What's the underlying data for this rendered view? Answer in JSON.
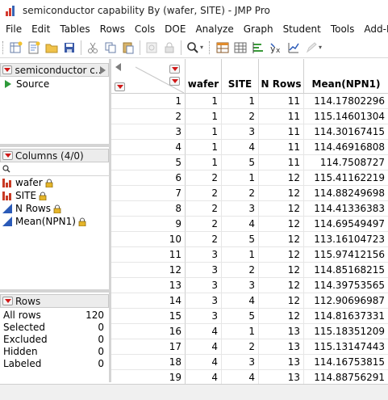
{
  "window": {
    "title": "semiconductor capability By (wafer, SITE) - JMP Pro"
  },
  "menu": [
    "File",
    "Edit",
    "Tables",
    "Rows",
    "Cols",
    "DOE",
    "Analyze",
    "Graph",
    "Student",
    "Tools",
    "Add-Ins"
  ],
  "toolbar": {
    "icons": [
      "new-table-icon",
      "new-script-icon",
      "open-icon",
      "save-icon",
      "cut-icon",
      "copy-icon",
      "paste-icon",
      "disabled-icon",
      "lock-icon",
      "search-icon",
      "data-table-icon",
      "grid-icon",
      "distribution-icon",
      "fit-icon",
      "graph-builder-icon",
      "disabled-edit-icon"
    ]
  },
  "table_panel": {
    "title": "semiconductor c...",
    "source_label": "Source"
  },
  "columns_panel": {
    "title": "Columns (4/0)",
    "columns": [
      {
        "name": "wafer",
        "type": "nominal"
      },
      {
        "name": "SITE",
        "type": "nominal"
      },
      {
        "name": "N Rows",
        "type": "continuous"
      },
      {
        "name": "Mean(NPN1)",
        "type": "continuous"
      }
    ]
  },
  "rows_panel": {
    "title": "Rows",
    "items": [
      {
        "label": "All rows",
        "value": "120"
      },
      {
        "label": "Selected",
        "value": "0"
      },
      {
        "label": "Excluded",
        "value": "0"
      },
      {
        "label": "Hidden",
        "value": "0"
      },
      {
        "label": "Labeled",
        "value": "0"
      }
    ]
  },
  "grid": {
    "headers": [
      "wafer",
      "SITE",
      "N Rows",
      "Mean(NPN1)"
    ],
    "rows": [
      [
        "1",
        "1",
        "1",
        "11",
        "114.17802296"
      ],
      [
        "2",
        "1",
        "2",
        "11",
        "115.14601304"
      ],
      [
        "3",
        "1",
        "3",
        "11",
        "114.30167415"
      ],
      [
        "4",
        "1",
        "4",
        "11",
        "114.46916808"
      ],
      [
        "5",
        "1",
        "5",
        "11",
        "114.7508727"
      ],
      [
        "6",
        "2",
        "1",
        "12",
        "115.41162219"
      ],
      [
        "7",
        "2",
        "2",
        "12",
        "114.88249698"
      ],
      [
        "8",
        "2",
        "3",
        "12",
        "114.41336383"
      ],
      [
        "9",
        "2",
        "4",
        "12",
        "114.69549497"
      ],
      [
        "10",
        "2",
        "5",
        "12",
        "113.16104723"
      ],
      [
        "11",
        "3",
        "1",
        "12",
        "115.97412156"
      ],
      [
        "12",
        "3",
        "2",
        "12",
        "114.85168215"
      ],
      [
        "13",
        "3",
        "3",
        "12",
        "114.39753565"
      ],
      [
        "14",
        "3",
        "4",
        "12",
        "112.90696987"
      ],
      [
        "15",
        "3",
        "5",
        "12",
        "114.81637331"
      ],
      [
        "16",
        "4",
        "1",
        "13",
        "115.18351209"
      ],
      [
        "17",
        "4",
        "2",
        "13",
        "115.13147443"
      ],
      [
        "18",
        "4",
        "3",
        "13",
        "114.16753815"
      ],
      [
        "19",
        "4",
        "4",
        "13",
        "114.88756291"
      ]
    ]
  }
}
